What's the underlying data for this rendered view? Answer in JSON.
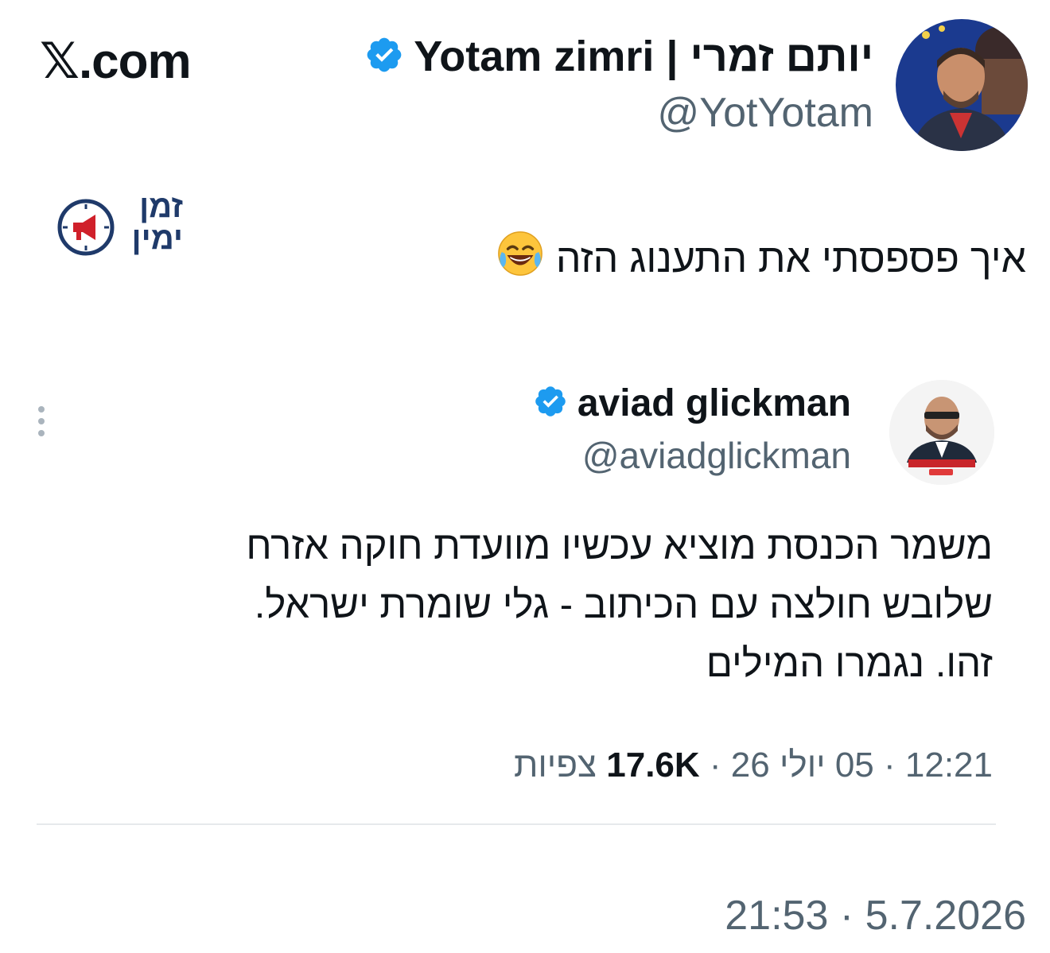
{
  "brand": {
    "text": "𝕏.com"
  },
  "author": {
    "name": "Yotam zimri | יותם זמרי",
    "handle": "@YotYotam",
    "avatar_icon": "person-avatar",
    "verified_icon": "verified-badge-icon",
    "verified_color": "#1d9bf0"
  },
  "watermark": {
    "line1": "זמן",
    "line2": "ימין",
    "color": "#1f3a6a",
    "icon": "clock-megaphone-icon",
    "accent": "#d0202a"
  },
  "tweet": {
    "text": "איך פספסתי את התענוג הזה",
    "emoji": "😂"
  },
  "quote": {
    "name": "aviad glickman",
    "handle": "@aviadglickman",
    "avatar_icon": "person-avatar",
    "more_icon": "more-vertical-icon",
    "body_lines": [
      "משמר הכנסת מוציא עכשיו מוועדת חוקה אזרח",
      "שלובש חולצה עם הכיתוב - גלי שומרת ישראל.",
      "זהו. נגמרו המילים"
    ],
    "meta": {
      "time": "12:21",
      "date": "05 יולי 26",
      "views": "17.6K",
      "views_label": "צפיות",
      "sep": "·"
    }
  },
  "post_time": "21:53 · 5.7.2026"
}
